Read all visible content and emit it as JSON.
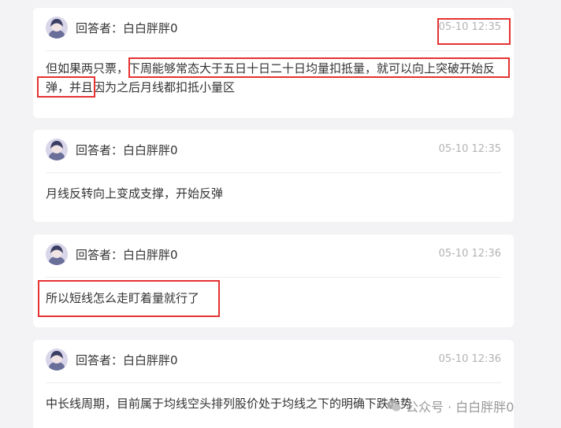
{
  "answers": [
    {
      "answerer": "回答者：白白胖胖0",
      "time": "05-10 12:35",
      "text": "但如果两只票，下周能够常态大于五日十日二十日均量扣抵量，就可以向上突破开始反弹，并且因为之后月线都扣抵小量区"
    },
    {
      "answerer": "回答者：白白胖胖0",
      "time": "05-10 12:35",
      "text": "月线反转向上变成支撑，开始反弹"
    },
    {
      "answerer": "回答者：白白胖胖0",
      "time": "05-10 12:36",
      "text": "所以短线怎么走盯着量就行了"
    },
    {
      "answerer": "回答者：白白胖胖0",
      "time": "05-10 12:36",
      "text": "中长线周期，目前属于均线空头排列股价处于均线之下的明确下跌趋势"
    }
  ],
  "watermark": {
    "text": "公众号 · 白白胖胖0",
    "icon": "wechat-icon"
  },
  "colors": {
    "highlight": "#e53232",
    "background": "#f3f3f5",
    "card": "#ffffff",
    "time": "#b3b3b3"
  }
}
